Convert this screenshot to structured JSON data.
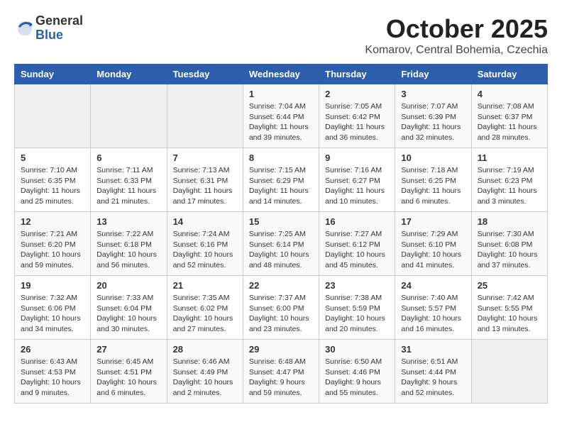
{
  "header": {
    "logo_general": "General",
    "logo_blue": "Blue",
    "month_title": "October 2025",
    "location": "Komarov, Central Bohemia, Czechia"
  },
  "days_of_week": [
    "Sunday",
    "Monday",
    "Tuesday",
    "Wednesday",
    "Thursday",
    "Friday",
    "Saturday"
  ],
  "weeks": [
    [
      {
        "day": "",
        "info": ""
      },
      {
        "day": "",
        "info": ""
      },
      {
        "day": "",
        "info": ""
      },
      {
        "day": "1",
        "info": "Sunrise: 7:04 AM\nSunset: 6:44 PM\nDaylight: 11 hours\nand 39 minutes."
      },
      {
        "day": "2",
        "info": "Sunrise: 7:05 AM\nSunset: 6:42 PM\nDaylight: 11 hours\nand 36 minutes."
      },
      {
        "day": "3",
        "info": "Sunrise: 7:07 AM\nSunset: 6:39 PM\nDaylight: 11 hours\nand 32 minutes."
      },
      {
        "day": "4",
        "info": "Sunrise: 7:08 AM\nSunset: 6:37 PM\nDaylight: 11 hours\nand 28 minutes."
      }
    ],
    [
      {
        "day": "5",
        "info": "Sunrise: 7:10 AM\nSunset: 6:35 PM\nDaylight: 11 hours\nand 25 minutes."
      },
      {
        "day": "6",
        "info": "Sunrise: 7:11 AM\nSunset: 6:33 PM\nDaylight: 11 hours\nand 21 minutes."
      },
      {
        "day": "7",
        "info": "Sunrise: 7:13 AM\nSunset: 6:31 PM\nDaylight: 11 hours\nand 17 minutes."
      },
      {
        "day": "8",
        "info": "Sunrise: 7:15 AM\nSunset: 6:29 PM\nDaylight: 11 hours\nand 14 minutes."
      },
      {
        "day": "9",
        "info": "Sunrise: 7:16 AM\nSunset: 6:27 PM\nDaylight: 11 hours\nand 10 minutes."
      },
      {
        "day": "10",
        "info": "Sunrise: 7:18 AM\nSunset: 6:25 PM\nDaylight: 11 hours\nand 6 minutes."
      },
      {
        "day": "11",
        "info": "Sunrise: 7:19 AM\nSunset: 6:23 PM\nDaylight: 11 hours\nand 3 minutes."
      }
    ],
    [
      {
        "day": "12",
        "info": "Sunrise: 7:21 AM\nSunset: 6:20 PM\nDaylight: 10 hours\nand 59 minutes."
      },
      {
        "day": "13",
        "info": "Sunrise: 7:22 AM\nSunset: 6:18 PM\nDaylight: 10 hours\nand 56 minutes."
      },
      {
        "day": "14",
        "info": "Sunrise: 7:24 AM\nSunset: 6:16 PM\nDaylight: 10 hours\nand 52 minutes."
      },
      {
        "day": "15",
        "info": "Sunrise: 7:25 AM\nSunset: 6:14 PM\nDaylight: 10 hours\nand 48 minutes."
      },
      {
        "day": "16",
        "info": "Sunrise: 7:27 AM\nSunset: 6:12 PM\nDaylight: 10 hours\nand 45 minutes."
      },
      {
        "day": "17",
        "info": "Sunrise: 7:29 AM\nSunset: 6:10 PM\nDaylight: 10 hours\nand 41 minutes."
      },
      {
        "day": "18",
        "info": "Sunrise: 7:30 AM\nSunset: 6:08 PM\nDaylight: 10 hours\nand 37 minutes."
      }
    ],
    [
      {
        "day": "19",
        "info": "Sunrise: 7:32 AM\nSunset: 6:06 PM\nDaylight: 10 hours\nand 34 minutes."
      },
      {
        "day": "20",
        "info": "Sunrise: 7:33 AM\nSunset: 6:04 PM\nDaylight: 10 hours\nand 30 minutes."
      },
      {
        "day": "21",
        "info": "Sunrise: 7:35 AM\nSunset: 6:02 PM\nDaylight: 10 hours\nand 27 minutes."
      },
      {
        "day": "22",
        "info": "Sunrise: 7:37 AM\nSunset: 6:00 PM\nDaylight: 10 hours\nand 23 minutes."
      },
      {
        "day": "23",
        "info": "Sunrise: 7:38 AM\nSunset: 5:59 PM\nDaylight: 10 hours\nand 20 minutes."
      },
      {
        "day": "24",
        "info": "Sunrise: 7:40 AM\nSunset: 5:57 PM\nDaylight: 10 hours\nand 16 minutes."
      },
      {
        "day": "25",
        "info": "Sunrise: 7:42 AM\nSunset: 5:55 PM\nDaylight: 10 hours\nand 13 minutes."
      }
    ],
    [
      {
        "day": "26",
        "info": "Sunrise: 6:43 AM\nSunset: 4:53 PM\nDaylight: 10 hours\nand 9 minutes."
      },
      {
        "day": "27",
        "info": "Sunrise: 6:45 AM\nSunset: 4:51 PM\nDaylight: 10 hours\nand 6 minutes."
      },
      {
        "day": "28",
        "info": "Sunrise: 6:46 AM\nSunset: 4:49 PM\nDaylight: 10 hours\nand 2 minutes."
      },
      {
        "day": "29",
        "info": "Sunrise: 6:48 AM\nSunset: 4:47 PM\nDaylight: 9 hours\nand 59 minutes."
      },
      {
        "day": "30",
        "info": "Sunrise: 6:50 AM\nSunset: 4:46 PM\nDaylight: 9 hours\nand 55 minutes."
      },
      {
        "day": "31",
        "info": "Sunrise: 6:51 AM\nSunset: 4:44 PM\nDaylight: 9 hours\nand 52 minutes."
      },
      {
        "day": "",
        "info": ""
      }
    ]
  ]
}
